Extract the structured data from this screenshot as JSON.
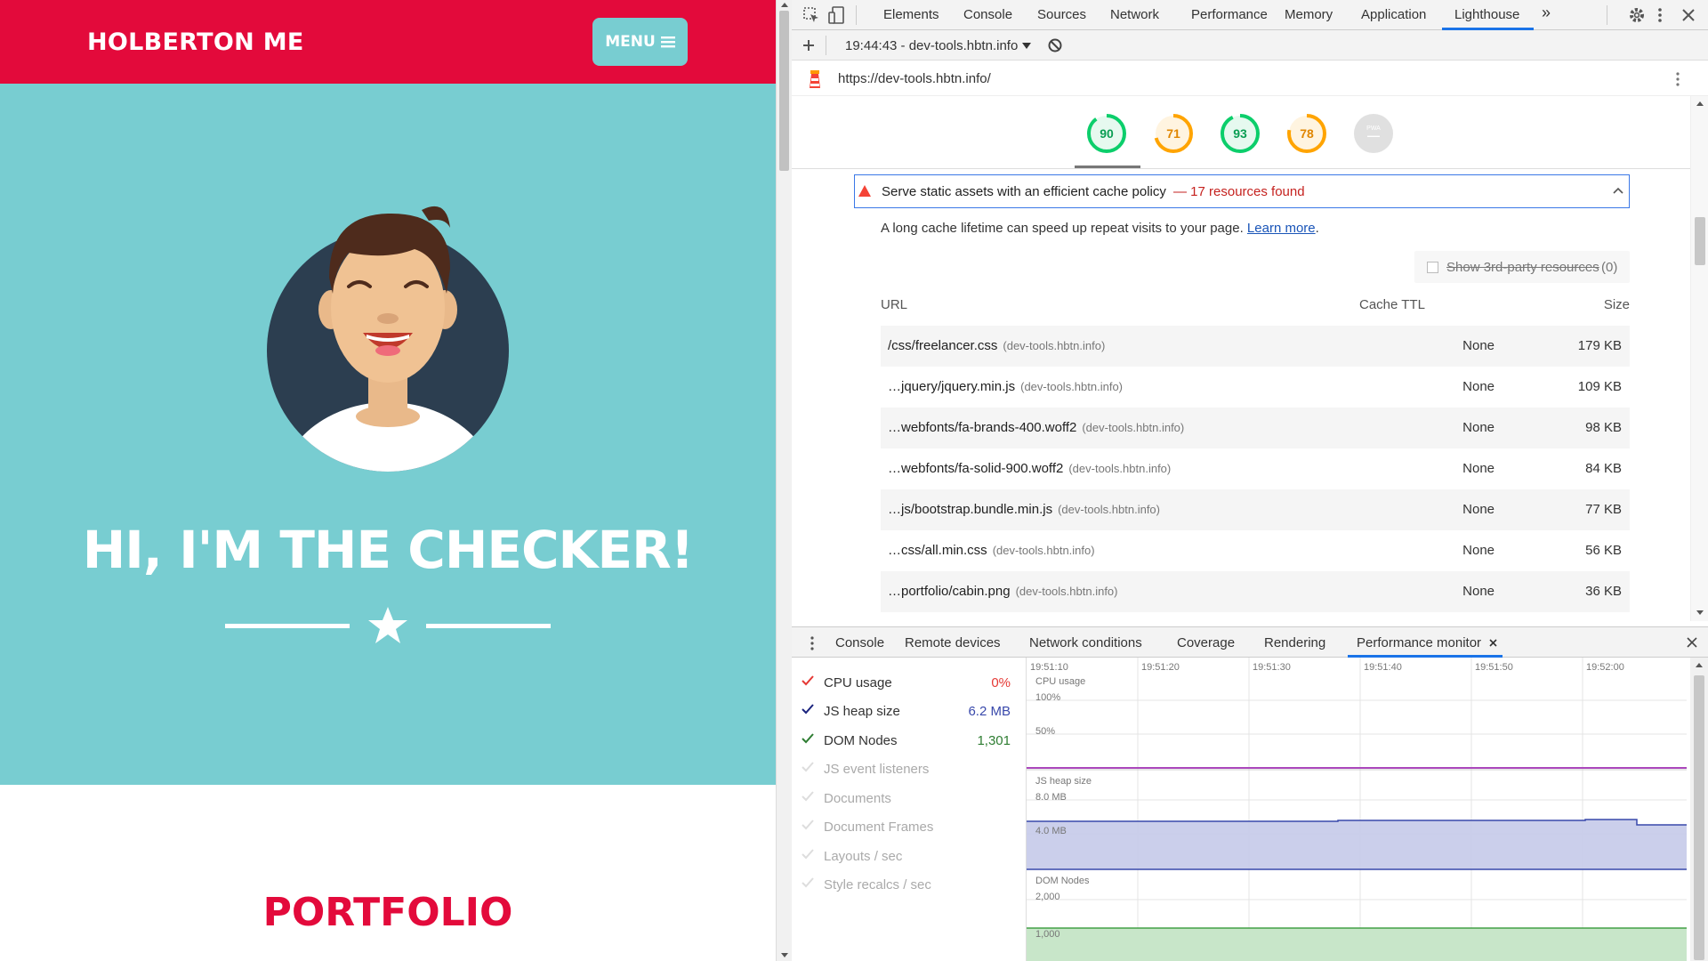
{
  "site": {
    "brand": "HOLBERTON ME",
    "menu_label": "MENU",
    "hero_title": "HI, I'M THE CHECKER!",
    "portfolio_title": "PORTFOLIO",
    "colors": {
      "nav": "#e30a3b",
      "hero": "#78cdd1",
      "accent": "#e30a3b"
    }
  },
  "devtools": {
    "tabs": [
      "Elements",
      "Console",
      "Sources",
      "Network",
      "Performance",
      "Memory",
      "Application",
      "Lighthouse"
    ],
    "active_tab": "Lighthouse",
    "more_tabs": "»",
    "report_selector": "19:44:43 - dev-tools.hbtn.info",
    "url": "https://dev-tools.hbtn.info/",
    "scores": [
      {
        "value": "90",
        "color": "#0cce6b"
      },
      {
        "value": "71",
        "color": "#ffa400"
      },
      {
        "value": "93",
        "color": "#0cce6b"
      },
      {
        "value": "78",
        "color": "#ffa400"
      },
      {
        "value": "—",
        "label": "PWA",
        "color": "#bdbdbd"
      }
    ],
    "audit": {
      "title": "Serve static assets with an efficient cache policy",
      "summary": "— 17 resources found",
      "description": "A long cache lifetime can speed up repeat visits to your page.",
      "learn_more": "Learn more",
      "third_party_label": "Show 3rd-party resources",
      "third_party_count": "(0)",
      "headers": {
        "url": "URL",
        "ttl": "Cache TTL",
        "size": "Size"
      },
      "rows": [
        {
          "url": "/css/freelancer.css",
          "host": "(dev-tools.hbtn.info)",
          "ttl": "None",
          "size": "179 KB"
        },
        {
          "url": "…jquery/jquery.min.js",
          "host": "(dev-tools.hbtn.info)",
          "ttl": "None",
          "size": "109 KB"
        },
        {
          "url": "…webfonts/fa-brands-400.woff2",
          "host": "(dev-tools.hbtn.info)",
          "ttl": "None",
          "size": "98 KB"
        },
        {
          "url": "…webfonts/fa-solid-900.woff2",
          "host": "(dev-tools.hbtn.info)",
          "ttl": "None",
          "size": "84 KB"
        },
        {
          "url": "…js/bootstrap.bundle.min.js",
          "host": "(dev-tools.hbtn.info)",
          "ttl": "None",
          "size": "77 KB"
        },
        {
          "url": "…css/all.min.css",
          "host": "(dev-tools.hbtn.info)",
          "ttl": "None",
          "size": "56 KB"
        },
        {
          "url": "…portfolio/cabin.png",
          "host": "(dev-tools.hbtn.info)",
          "ttl": "None",
          "size": "36 KB"
        }
      ]
    },
    "drawer": {
      "tabs": [
        "Console",
        "Remote devices",
        "Network conditions",
        "Coverage",
        "Rendering",
        "Performance monitor"
      ],
      "active_tab": "Performance monitor",
      "metrics": [
        {
          "label": "CPU usage",
          "value": "0%",
          "checked": true,
          "color": "#e53935"
        },
        {
          "label": "JS heap size",
          "value": "6.2 MB",
          "checked": true,
          "color": "#1a237e"
        },
        {
          "label": "DOM Nodes",
          "value": "1,301",
          "checked": true,
          "color": "#2e7d32"
        },
        {
          "label": "JS event listeners",
          "value": "",
          "checked": false
        },
        {
          "label": "Documents",
          "value": "",
          "checked": false
        },
        {
          "label": "Document Frames",
          "value": "",
          "checked": false
        },
        {
          "label": "Layouts / sec",
          "value": "",
          "checked": false
        },
        {
          "label": "Style recalcs / sec",
          "value": "",
          "checked": false
        }
      ],
      "time_ticks": [
        "19:51:10",
        "19:51:20",
        "19:51:30",
        "19:51:40",
        "19:51:50",
        "19:52:00"
      ],
      "graphs": {
        "cpu": {
          "title": "CPU usage",
          "labels": [
            "100%",
            "50%"
          ],
          "color": "#ab47bc"
        },
        "heap": {
          "title": "JS heap size",
          "labels": [
            "8.0 MB",
            "4.0 MB"
          ],
          "color": "#3949ab"
        },
        "dom": {
          "title": "DOM Nodes",
          "labels": [
            "2,000",
            "1,000"
          ],
          "color": "#43a047"
        }
      }
    }
  }
}
